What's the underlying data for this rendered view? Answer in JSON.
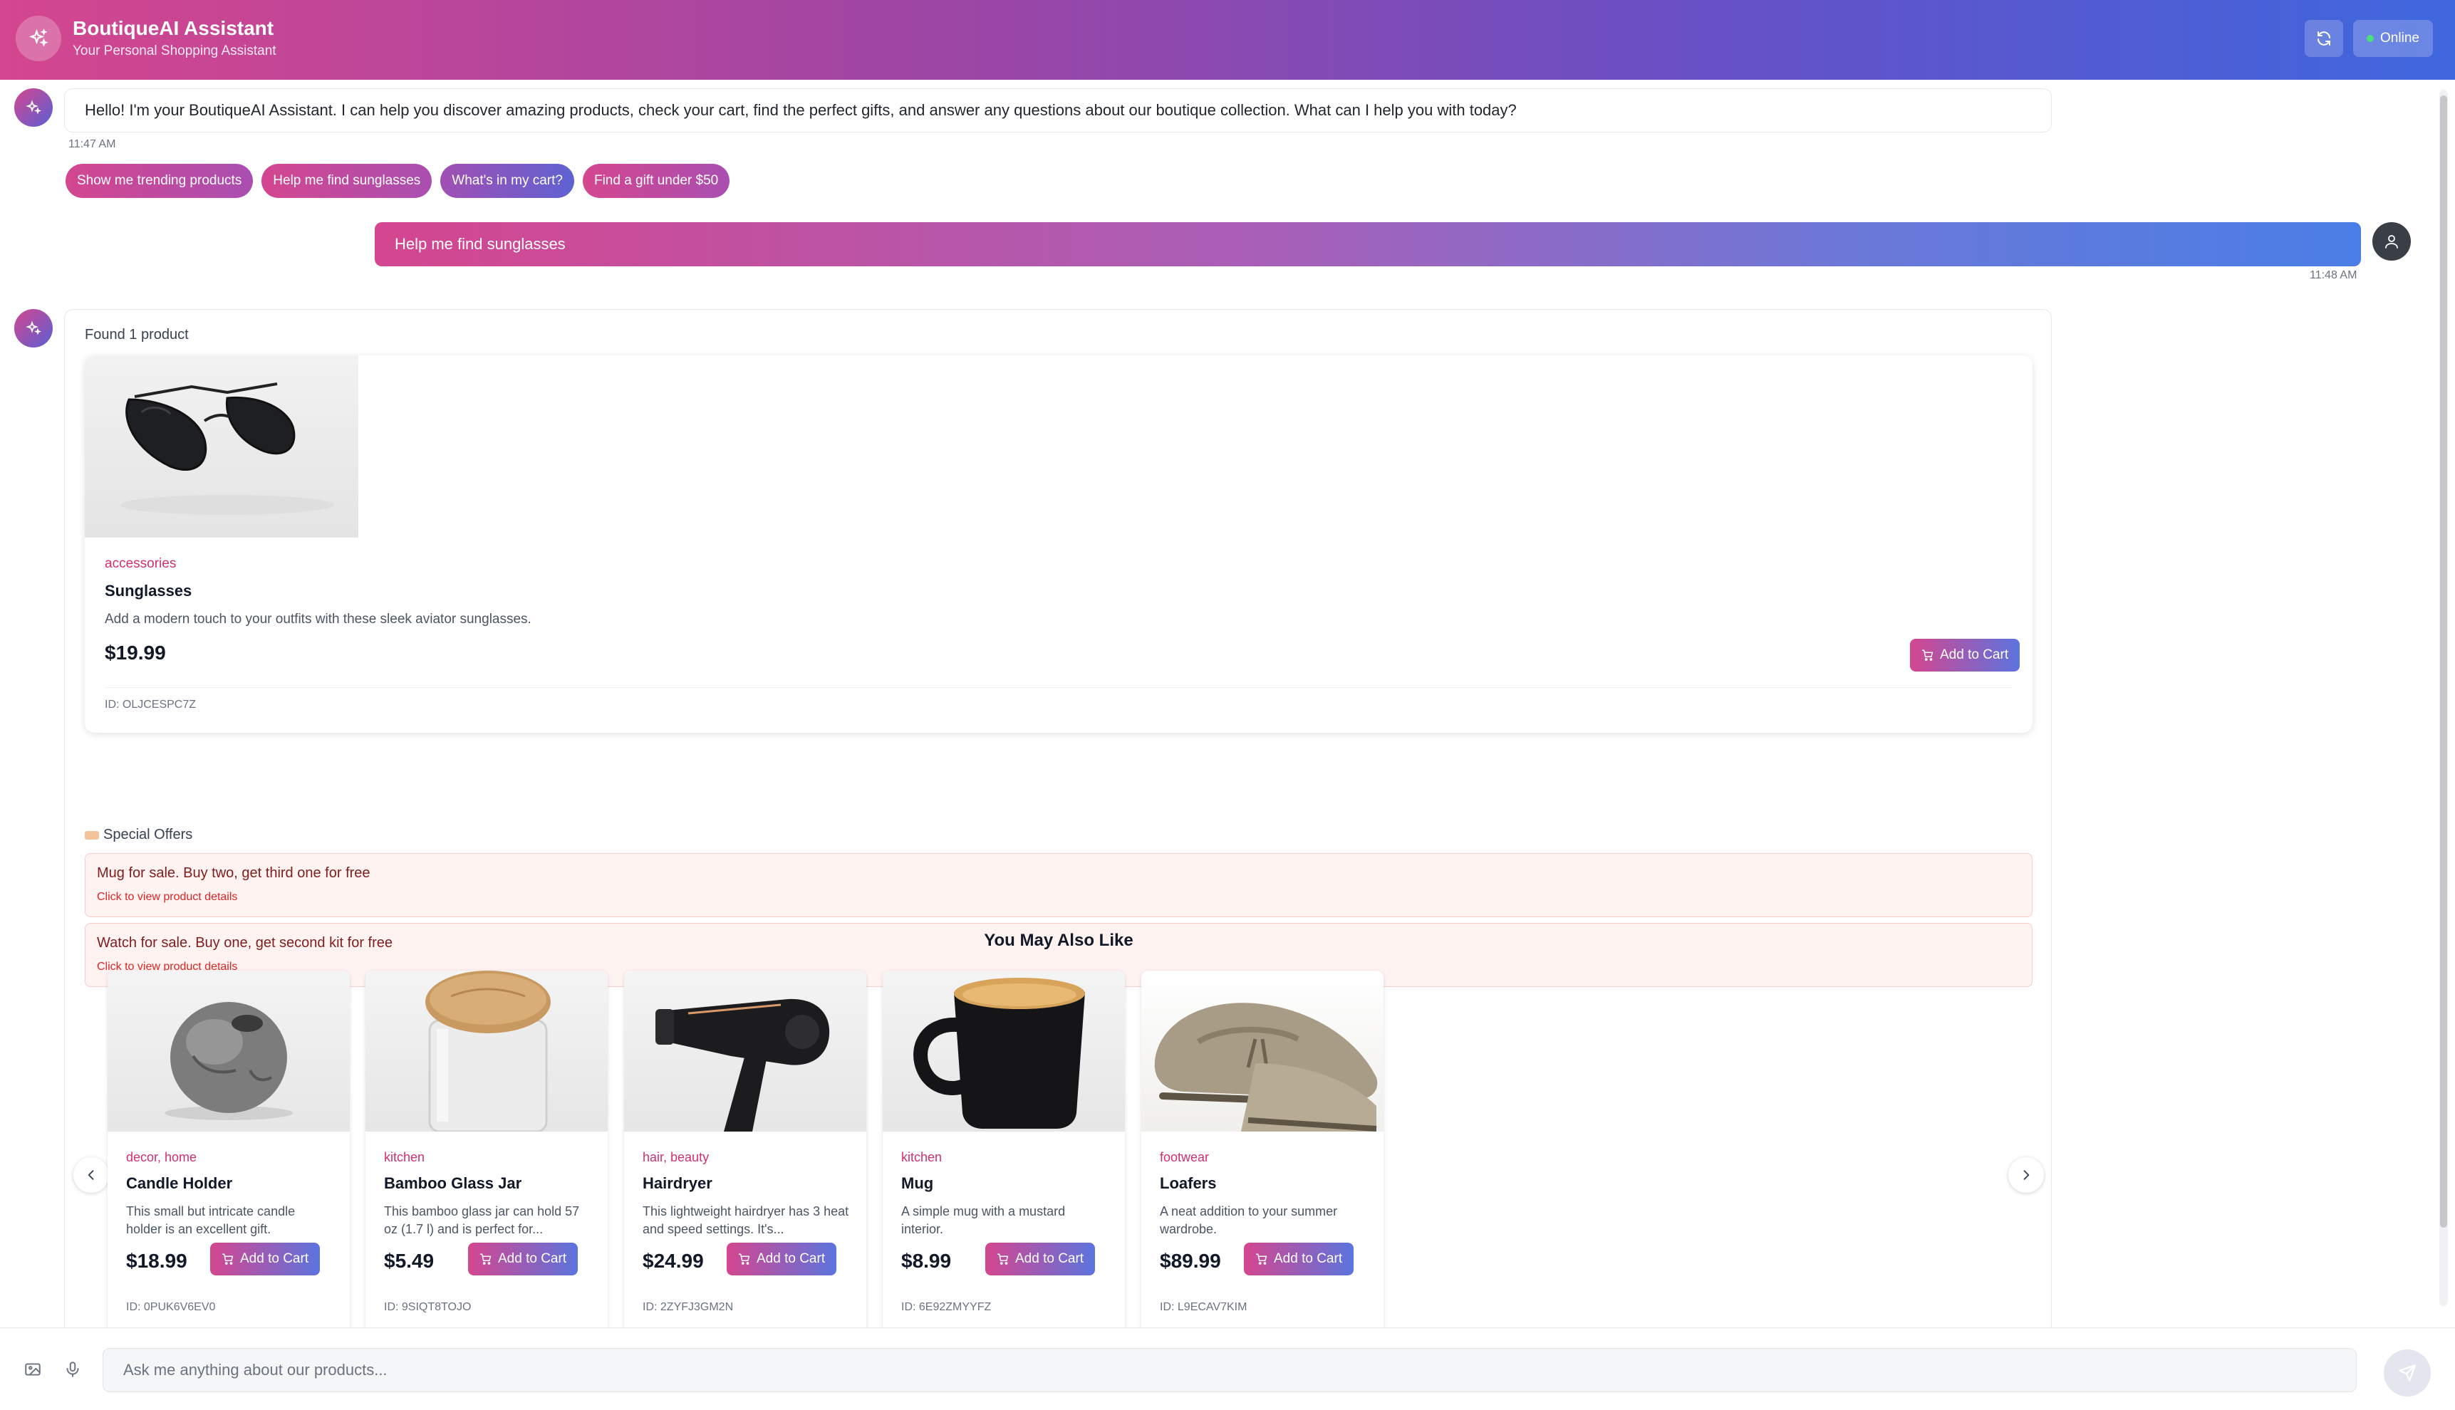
{
  "header": {
    "title": "BoutiqueAI Assistant",
    "subtitle": "Your Personal Shopping Assistant",
    "status": "Online",
    "refresh_icon": "refresh-icon",
    "brand_icon": "sparkles-icon"
  },
  "messages": {
    "welcome": {
      "text": "Hello! I'm your BoutiqueAI Assistant. I can help you discover amazing products, check your cart, find the perfect gifts, and answer any questions about our boutique collection. What can I help you with today?",
      "time": "11:47 AM"
    },
    "suggestions": [
      "Show me trending products",
      "Help me find sunglasses",
      "What's in my cart?",
      "Find a gift under $50"
    ],
    "user": {
      "text": "Help me find sunglasses",
      "time": "11:48 AM"
    },
    "response": {
      "found": "Found 1 product",
      "product": {
        "category": "accessories",
        "name": "Sunglasses",
        "description": "Add a modern touch to your outfits with these sleek aviator sunglasses.",
        "price": "$19.99",
        "id": "ID: OLJCESPC7Z",
        "add_label": "Add to Cart"
      },
      "offers": {
        "heading": "Special Offers",
        "items": [
          {
            "title": "Mug for sale. Buy two, get third one for free",
            "link": "Click to view product details"
          },
          {
            "title": "Watch for sale. Buy one, get second kit for free",
            "link": "Click to view product details"
          }
        ]
      },
      "recommendations": {
        "title": "You May Also Like",
        "items": [
          {
            "category": "decor, home",
            "name": "Candle Holder",
            "description": "This small but intricate candle holder is an excellent gift.",
            "price": "$18.99",
            "id": "ID: 0PUK6V6EV0",
            "add_label": "Add to Cart"
          },
          {
            "category": "kitchen",
            "name": "Bamboo Glass Jar",
            "description": "This bamboo glass jar can hold 57 oz (1.7 l) and is perfect for...",
            "price": "$5.49",
            "id": "ID: 9SIQT8TOJO",
            "add_label": "Add to Cart"
          },
          {
            "category": "hair, beauty",
            "name": "Hairdryer",
            "description": "This lightweight hairdryer has 3 heat and speed settings. It's...",
            "price": "$24.99",
            "id": "ID: 2ZYFJ3GM2N",
            "add_label": "Add to Cart"
          },
          {
            "category": "kitchen",
            "name": "Mug",
            "description": "A simple mug with a mustard interior.",
            "price": "$8.99",
            "id": "ID: 6E92ZMYYFZ",
            "add_label": "Add to Cart"
          },
          {
            "category": "footwear",
            "name": "Loafers",
            "description": "A neat addition to your summer wardrobe.",
            "price": "$89.99",
            "id": "ID: L9ECAV7KIM",
            "add_label": "Add to Cart"
          }
        ]
      }
    }
  },
  "input": {
    "placeholder": "Ask me anything about our products...",
    "value": ""
  },
  "colors": {
    "accent_pink": "#d4468f",
    "accent_blue": "#4a7ee6",
    "category_text": "#d0306f",
    "offer_bg": "#fff3f1"
  }
}
